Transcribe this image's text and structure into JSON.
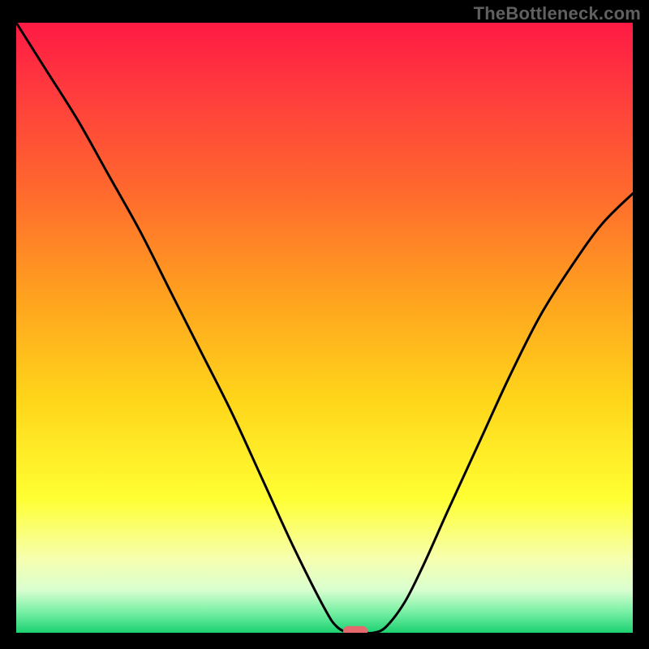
{
  "watermark": "TheBottleneck.com",
  "chart_data": {
    "type": "line",
    "title": "",
    "xlabel": "",
    "ylabel": "",
    "xlim": [
      0,
      100
    ],
    "ylim": [
      0,
      100
    ],
    "x": [
      0,
      5,
      10,
      15,
      20,
      25,
      30,
      35,
      40,
      45,
      50,
      52,
      54,
      56,
      58,
      60,
      63,
      66,
      70,
      75,
      80,
      85,
      90,
      95,
      100
    ],
    "y": [
      100,
      92,
      84,
      75,
      66,
      56,
      46,
      36,
      25,
      14,
      4,
      1,
      0,
      0,
      0,
      1,
      5,
      11,
      20,
      31,
      42,
      52,
      60,
      67,
      72
    ],
    "minimum_marker": {
      "x": 55,
      "y": 0.3
    },
    "gradient_stops": [
      {
        "offset": 0.0,
        "color": "#ff1a44"
      },
      {
        "offset": 0.12,
        "color": "#ff3d3d"
      },
      {
        "offset": 0.28,
        "color": "#ff6a2d"
      },
      {
        "offset": 0.45,
        "color": "#ffa21f"
      },
      {
        "offset": 0.62,
        "color": "#ffd61a"
      },
      {
        "offset": 0.78,
        "color": "#ffff33"
      },
      {
        "offset": 0.88,
        "color": "#f6ffb0"
      },
      {
        "offset": 0.93,
        "color": "#d9ffd0"
      },
      {
        "offset": 0.965,
        "color": "#7af0a5"
      },
      {
        "offset": 1.0,
        "color": "#1cd171"
      }
    ]
  }
}
